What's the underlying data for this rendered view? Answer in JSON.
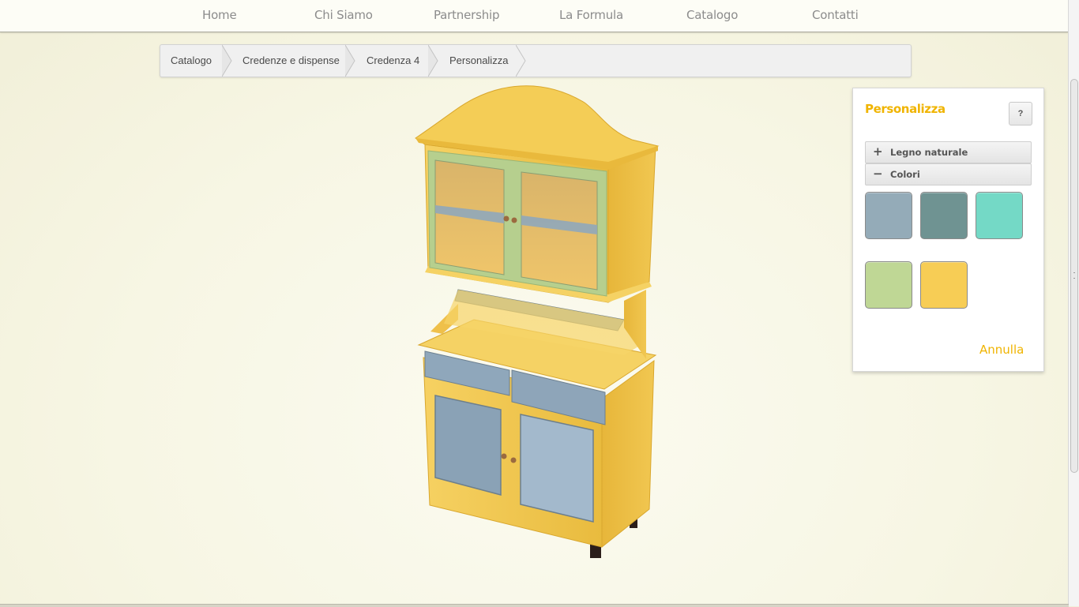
{
  "nav": {
    "items": [
      "Home",
      "Chi Siamo",
      "Partnership",
      "La Formula",
      "Catalogo",
      "Contatti"
    ]
  },
  "breadcrumb": {
    "items": [
      "Catalogo",
      "Credenze e dispense",
      "Credenza 4",
      "Personalizza"
    ]
  },
  "panel": {
    "title": "Personalizza",
    "help_label": "?",
    "sections": [
      {
        "icon": "+",
        "label": "Legno naturale",
        "state": "collapsed"
      },
      {
        "icon": "−",
        "label": "Colori",
        "state": "expanded"
      }
    ],
    "swatches": [
      {
        "name": "light-blue-grey",
        "color": "#94abb8"
      },
      {
        "name": "teal-grey",
        "color": "#6f9392"
      },
      {
        "name": "turquoise",
        "color": "#74d9c6"
      },
      {
        "name": "sage-green",
        "color": "#bfd795"
      },
      {
        "name": "yellow",
        "color": "#f7cd55"
      }
    ],
    "cancel_label": "Annulla"
  },
  "colors": {
    "accent": "#f0b400",
    "wood": "#f3c94f",
    "wood_dark": "#dcaa2c",
    "panel_blue": "#8fa7bb",
    "frame_green": "#b6cf8e"
  }
}
